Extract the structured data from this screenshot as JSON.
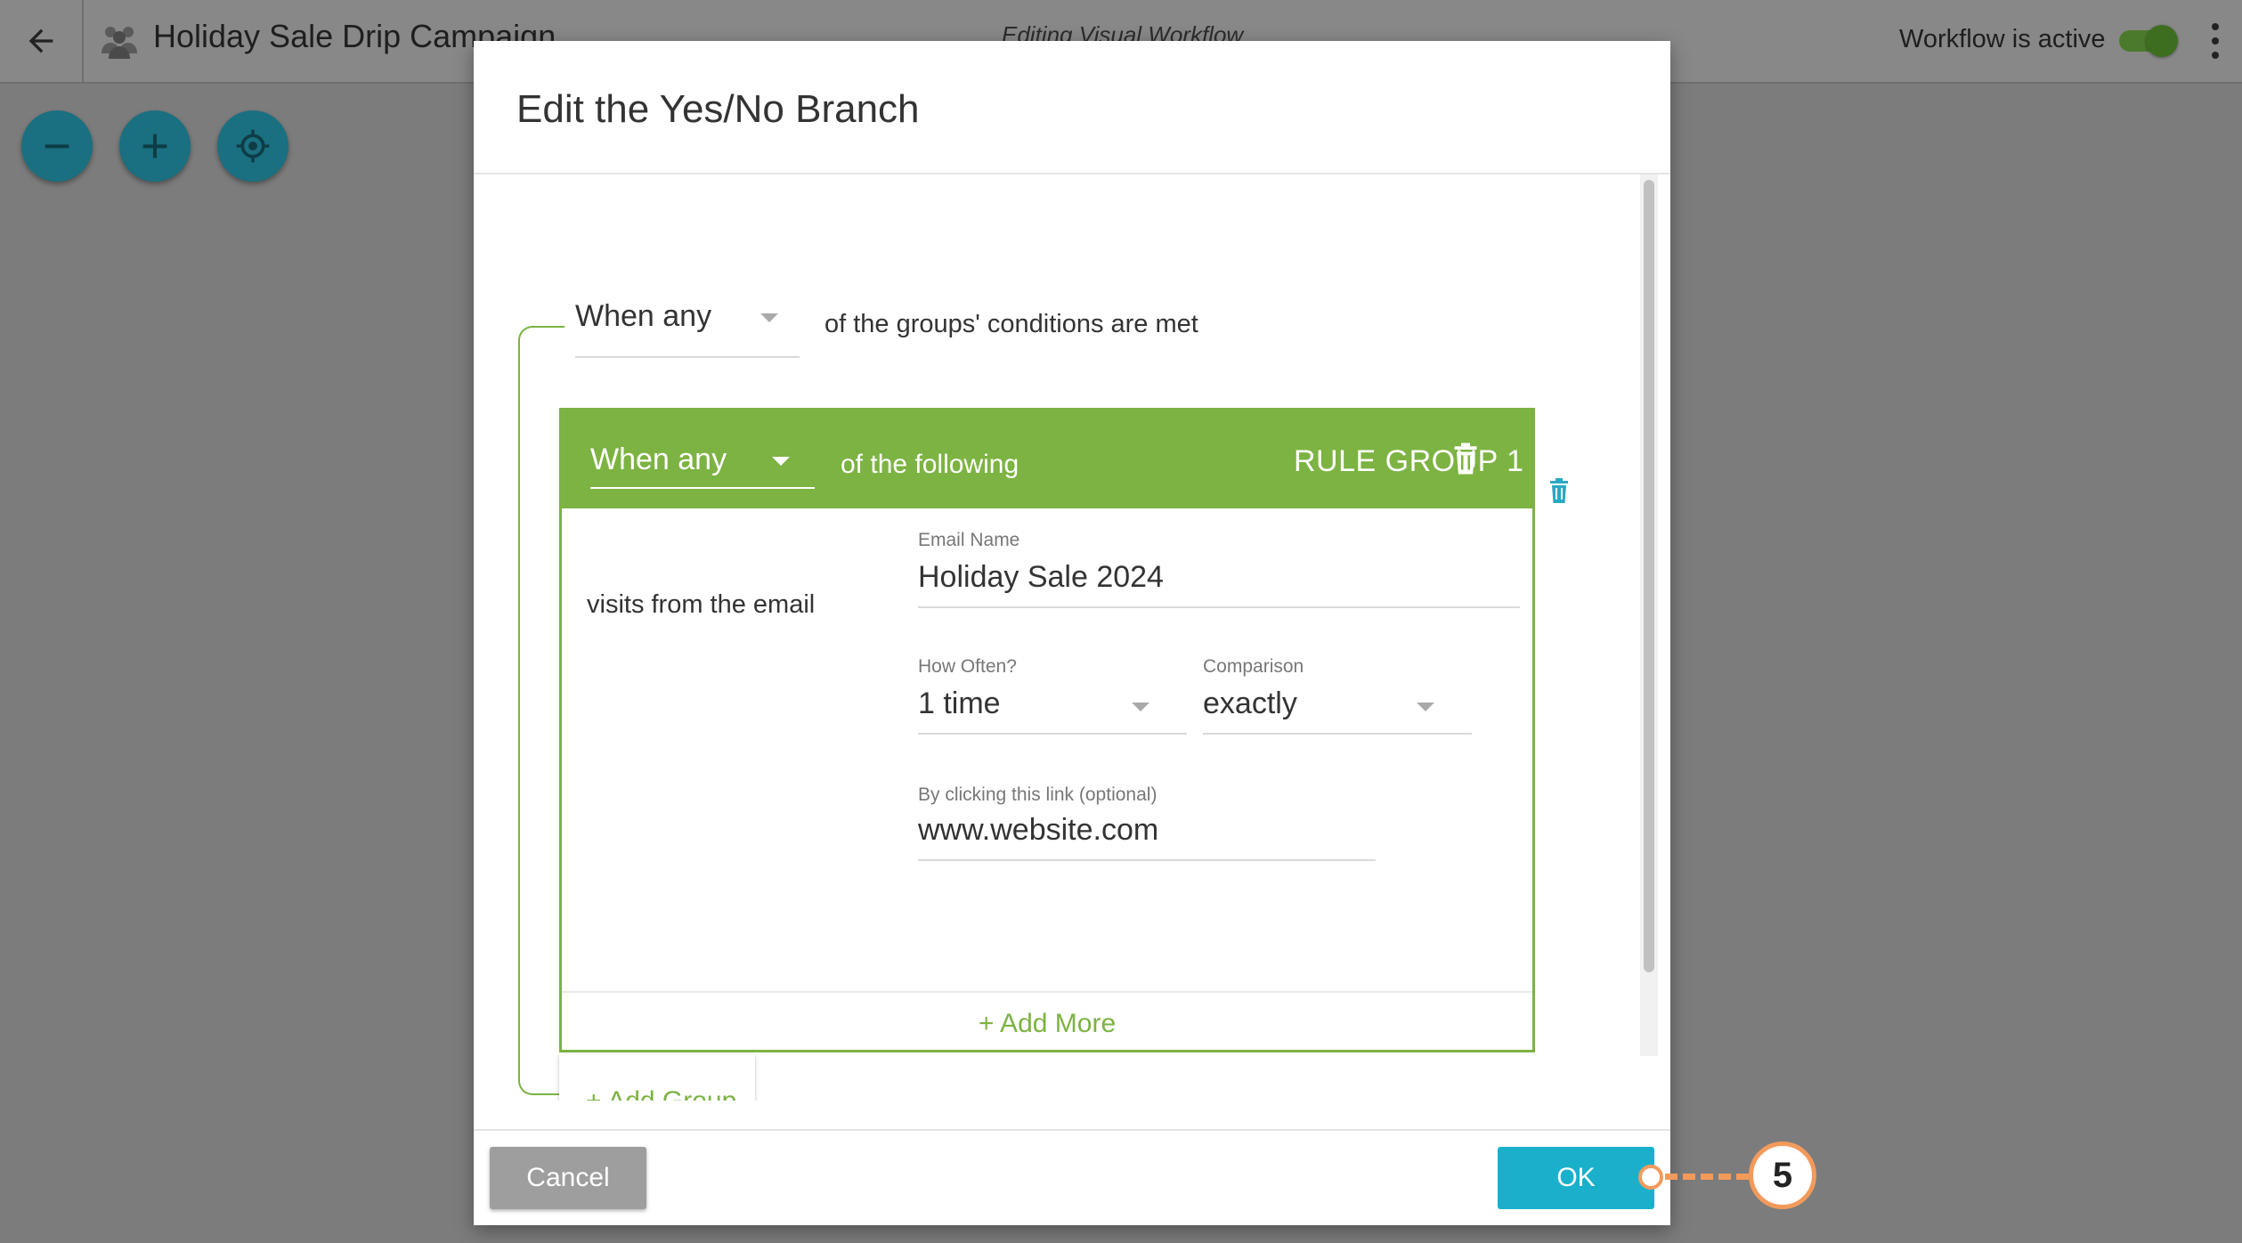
{
  "app": {
    "title": "Holiday Sale Drip Campaign",
    "mode_label": "Editing Visual Workflow",
    "active_label": "Workflow is active",
    "active": true
  },
  "toolbar": {
    "zoom_out_icon": "minus-icon",
    "zoom_in_icon": "plus-icon",
    "center_icon": "crosshair-icon"
  },
  "modal": {
    "title": "Edit the Yes/No Branch",
    "groups_match": {
      "selected": "When any",
      "suffix": "of the groups' conditions are met"
    },
    "rule_group": {
      "match_selected": "When any",
      "match_suffix": "of the following",
      "label": "RULE GROUP 1",
      "condition": {
        "label": "visits from the email",
        "email_name_label": "Email Name",
        "email_name_value": "Holiday Sale 2024",
        "how_often_label": "How Often?",
        "how_often_value": "1 time",
        "comparison_label": "Comparison",
        "comparison_value": "exactly",
        "link_label": "By clicking this link (optional)",
        "link_value": "www.website.com"
      },
      "add_more_label": "+ Add More"
    },
    "add_group_label": "+ Add Group",
    "cancel_label": "Cancel",
    "ok_label": "OK"
  },
  "callout": {
    "number": "5",
    "color": "#f39a5b"
  },
  "colors": {
    "accent_green": "#7cb342",
    "primary_cyan": "#1ab0cc",
    "fab_teal": "#1a6f80"
  }
}
